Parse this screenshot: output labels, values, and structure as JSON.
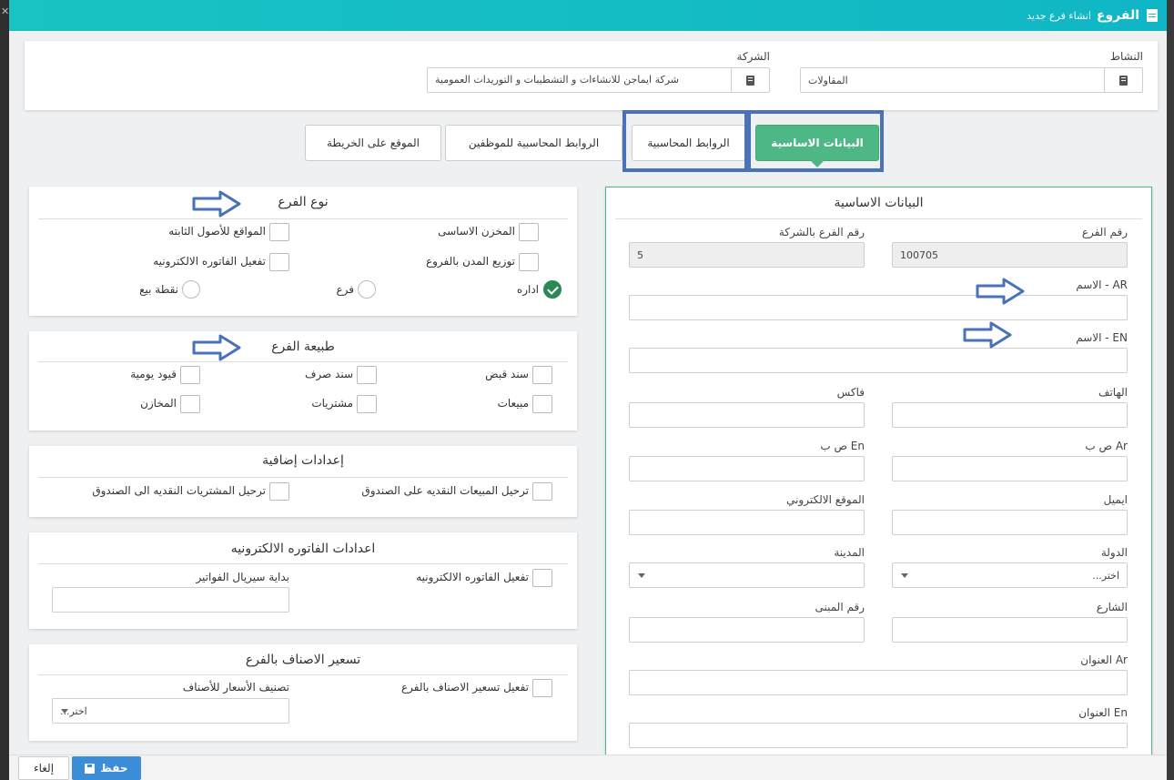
{
  "window": {
    "title_main": "الفروع",
    "title_sub": "انشاء فرع جديد",
    "close_glyph": "✕"
  },
  "top": {
    "activity_label": "النشاط",
    "activity_value": "المقاولات",
    "company_label": "الشركة",
    "company_value": "شركة ايماجن للانشاءات و التشطيبات و التوريدات العمومية"
  },
  "tabs": [
    {
      "label": "البيانات الاساسية",
      "active": true
    },
    {
      "label": "الروابط المحاسبية",
      "active": false
    },
    {
      "label": "الروابط المحاسبية للموظفين",
      "active": false
    },
    {
      "label": "الموقع على الخريطة",
      "active": false
    }
  ],
  "basic": {
    "title": "البيانات الاساسية",
    "branch_no_label": "رقم الفرع",
    "branch_no_value": "100705",
    "company_branch_no_label": "رقم الفرع بالشركة",
    "company_branch_no_value": "5",
    "name_ar_label": "الاسم - AR",
    "name_en_label": "الاسم - EN",
    "phone_label": "الهاتف",
    "fax_label": "فاكس",
    "pobox_ar_label": "ص ب Ar",
    "pobox_en_label": "ص ب En",
    "email_label": "ايميل",
    "website_label": "الموقع الالكتروني",
    "country_label": "الدولة",
    "country_value": "اختر...",
    "city_label": "المدينة",
    "street_label": "الشارع",
    "building_label": "رقم المبنى",
    "address_ar_label": "العنوان Ar",
    "address_en_label": "العنوان En"
  },
  "branch_type": {
    "title": "نوع الفرع",
    "main_store": "المخزن الاساسى",
    "fixed_assets": "المواقع للأصول الثابته",
    "city_dist": "توزيع المدن بالفروع",
    "einvoice": "تفعيل الفاتوره الالكترونيه",
    "admin": "اداره",
    "branch": "فرع",
    "pos": "نقطة بيع"
  },
  "branch_nature": {
    "title": "طبيعة الفرع",
    "receipt": "سند قبض",
    "payment": "سند صرف",
    "daily": "قيود يومية",
    "sales": "مبيعات",
    "purchases": "مشتريات",
    "stores": "المخازن"
  },
  "extra": {
    "title": "إعدادات إضافية",
    "sales_cash": "ترحيل المبيعات النقديه على الصندوق",
    "purch_cash": "ترحيل المشتريات النقديه الى الصندوق"
  },
  "einv": {
    "title": "اعدادات الفاتوره الالكترونيه",
    "activate": "تفعيل الفاتوره الالكترونيه",
    "serial_start": "بداية سيريال الفواتير"
  },
  "pricing": {
    "title": "تسعير الاصناف بالفرع",
    "activate": "تفعيل تسعير الاصناف بالفرع",
    "class_label": "تصنيف الأسعار للأصناف",
    "class_value": "اختر..."
  },
  "footer": {
    "save": "حفظ",
    "cancel": "إلغاء"
  },
  "colors": {
    "titlebar": "#10b6c5",
    "active_tab": "#4db886",
    "highlight": "#4a72b8",
    "save_btn": "#3c8dd8"
  }
}
